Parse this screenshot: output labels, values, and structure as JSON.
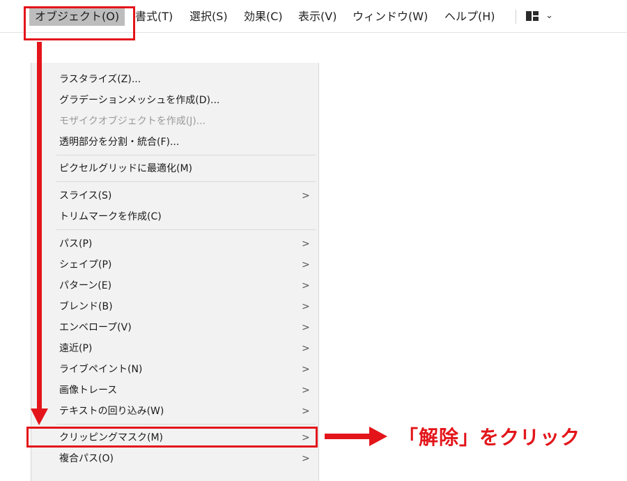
{
  "menubar": {
    "items": [
      {
        "label": "オブジェクト(O)",
        "active": true
      },
      {
        "label": "書式(T)"
      },
      {
        "label": "選択(S)"
      },
      {
        "label": "効果(C)"
      },
      {
        "label": "表示(V)"
      },
      {
        "label": "ウィンドウ(W)"
      },
      {
        "label": "ヘルプ(H)"
      }
    ],
    "layout_icon": "grid-layout-icon",
    "chevron": "⌄"
  },
  "dropdown": {
    "items": [
      {
        "label": "ラスタライズ(Z)...",
        "submenu": false
      },
      {
        "label": "グラデーションメッシュを作成(D)...",
        "submenu": false
      },
      {
        "label": "モザイクオブジェクトを作成(J)...",
        "submenu": false,
        "disabled": true
      },
      {
        "label": "透明部分を分割・統合(F)...",
        "submenu": false
      },
      {
        "label": "ピクセルグリッドに最適化(M)",
        "submenu": false
      },
      {
        "label": "スライス(S)",
        "submenu": true
      },
      {
        "label": "トリムマークを作成(C)",
        "submenu": false
      },
      {
        "label": "パス(P)",
        "submenu": true
      },
      {
        "label": "シェイプ(P)",
        "submenu": true
      },
      {
        "label": "パターン(E)",
        "submenu": true
      },
      {
        "label": "ブレンド(B)",
        "submenu": true
      },
      {
        "label": "エンベロープ(V)",
        "submenu": true
      },
      {
        "label": "遠近(P)",
        "submenu": true
      },
      {
        "label": "ライブペイント(N)",
        "submenu": true
      },
      {
        "label": "画像トレース",
        "submenu": true
      },
      {
        "label": "テキストの回り込み(W)",
        "submenu": true
      },
      {
        "label": "クリッピングマスク(M)",
        "submenu": true,
        "highlighted": true
      },
      {
        "label": "複合パス(O)",
        "submenu": true
      }
    ],
    "submenu_glyph": ">"
  },
  "annotation": {
    "text": "「解除」をクリック",
    "color": "#e3151a"
  }
}
